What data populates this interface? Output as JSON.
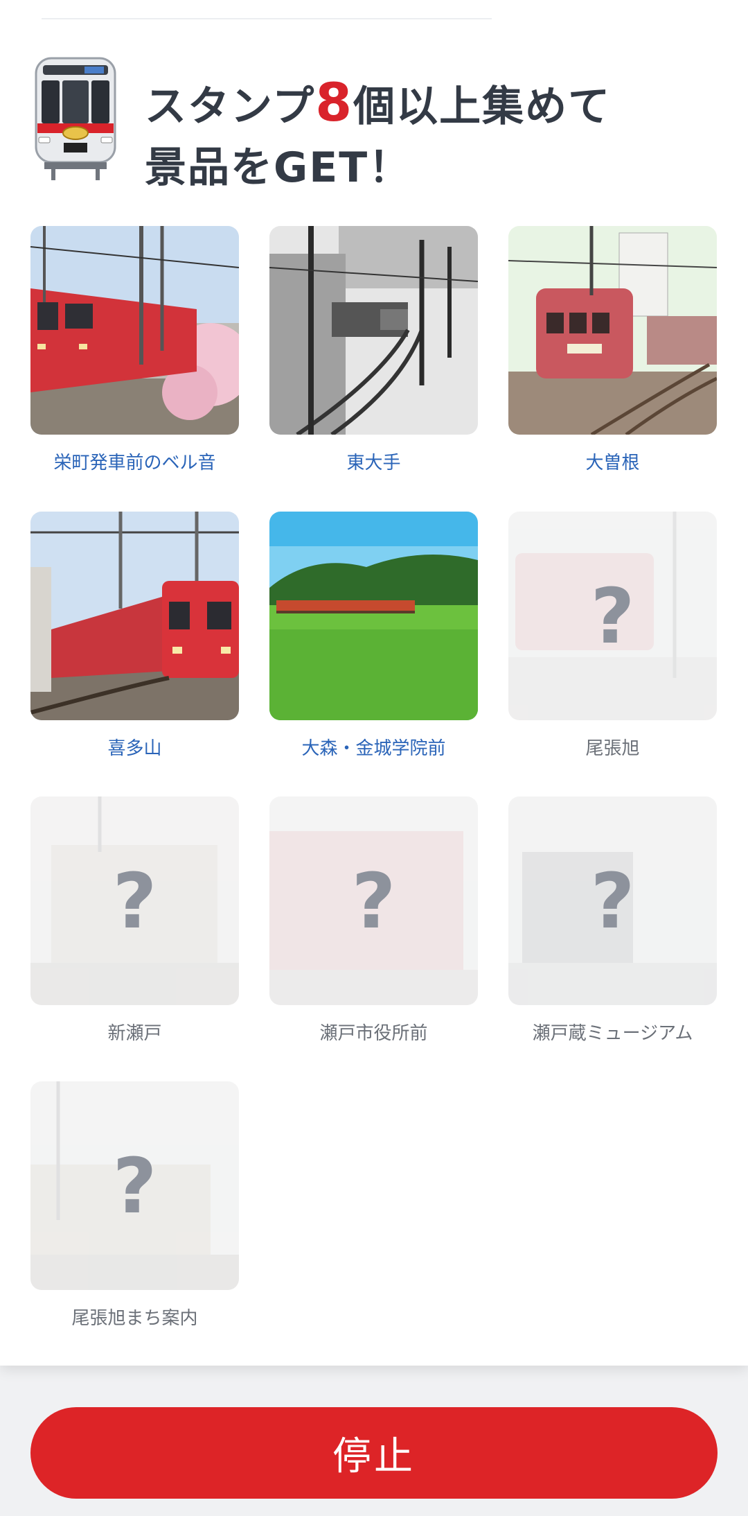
{
  "header": {
    "title_prefix": "スタンプ",
    "title_count": "8",
    "title_suffix": "個以上集めて",
    "title_line2": "景品をGET！"
  },
  "stamps": [
    {
      "label": "栄町発車前のベル音",
      "collected": true
    },
    {
      "label": "東大手",
      "collected": true
    },
    {
      "label": "大曽根",
      "collected": true
    },
    {
      "label": "喜多山",
      "collected": true
    },
    {
      "label": "大森・金城学院前",
      "collected": true
    },
    {
      "label": "尾張旭",
      "collected": false,
      "mark": "?"
    },
    {
      "label": "新瀬戸",
      "collected": false,
      "mark": "?"
    },
    {
      "label": "瀬戸市役所前",
      "collected": false,
      "mark": "?"
    },
    {
      "label": "瀬戸蔵ミュージアム",
      "collected": false,
      "mark": "?"
    },
    {
      "label": "尾張旭まち案内",
      "collected": false,
      "mark": "?"
    }
  ],
  "footer": {
    "stop_label": "停止"
  },
  "colors": {
    "accent": "#dd2427",
    "collected_label": "#2a64b8",
    "locked_label": "#6b7078"
  }
}
